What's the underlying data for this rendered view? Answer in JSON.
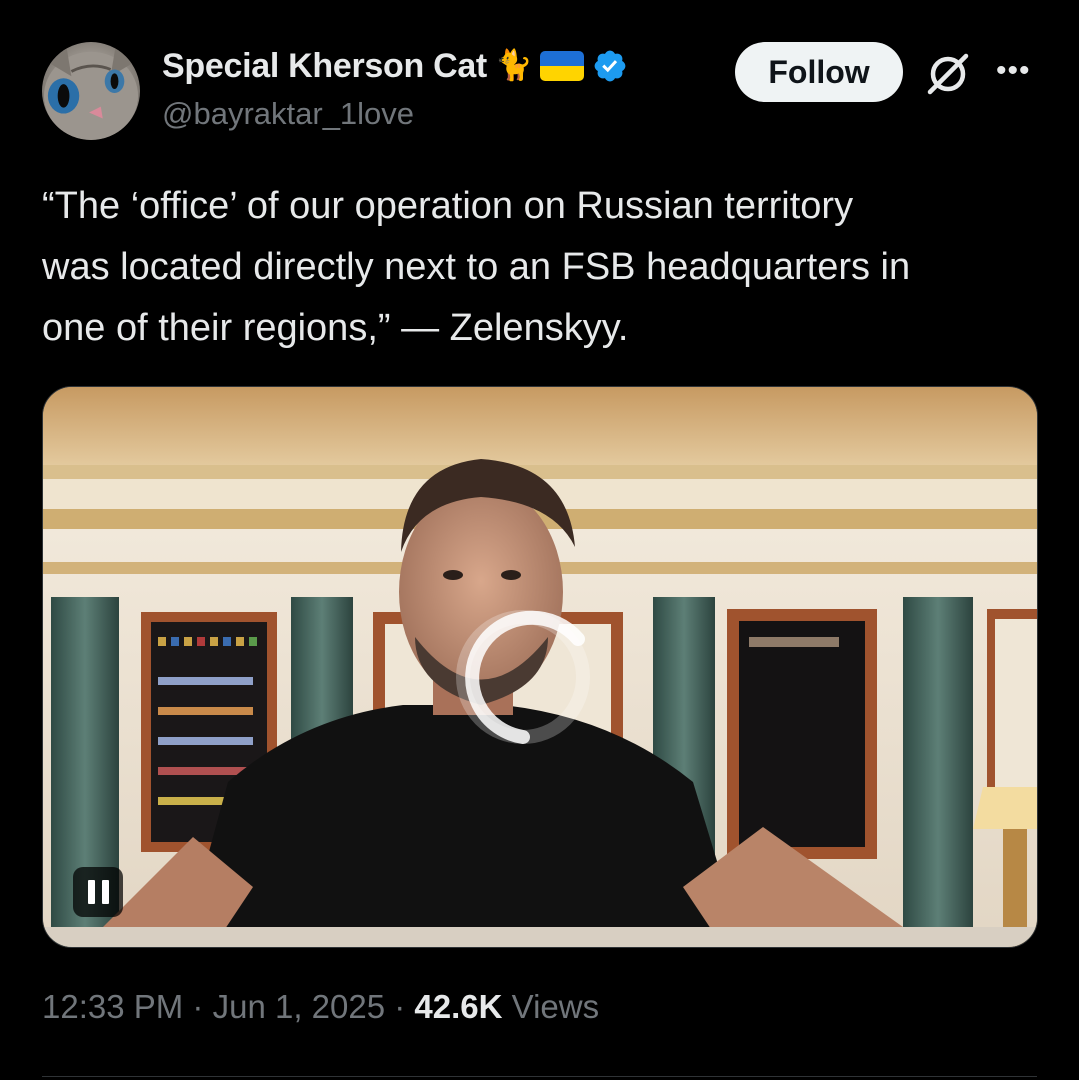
{
  "author": {
    "display_name": "Special Kherson Cat",
    "name_emoji": "🐈",
    "handle": "@bayraktar_1love",
    "flag_colors": [
      "#1d6fd6",
      "#ffd400"
    ],
    "verified_color": "#1d9bf0",
    "avatar_icon": "cat-avatar"
  },
  "actions": {
    "follow_label": "Follow",
    "grok_icon": "grok-icon",
    "more_label": "•••"
  },
  "tweet": {
    "text": "“The ‘office’ of our operation on Russian territory\nwas located directly next to an FSB headquarters in\none of their regions,” — Zelenskyy."
  },
  "media": {
    "type": "video",
    "state": "loading",
    "pause_icon": "pause-icon",
    "spinner_icon": "loading-spinner-icon"
  },
  "meta": {
    "time": "12:33 PM",
    "separator": "·",
    "date": "Jun 1, 2025",
    "views_count": "42.6K",
    "views_label": "Views"
  },
  "colors": {
    "background": "#000000",
    "primary_text": "#e7e9ea",
    "secondary_text": "#71767b",
    "follow_button_bg": "#eff3f4"
  }
}
